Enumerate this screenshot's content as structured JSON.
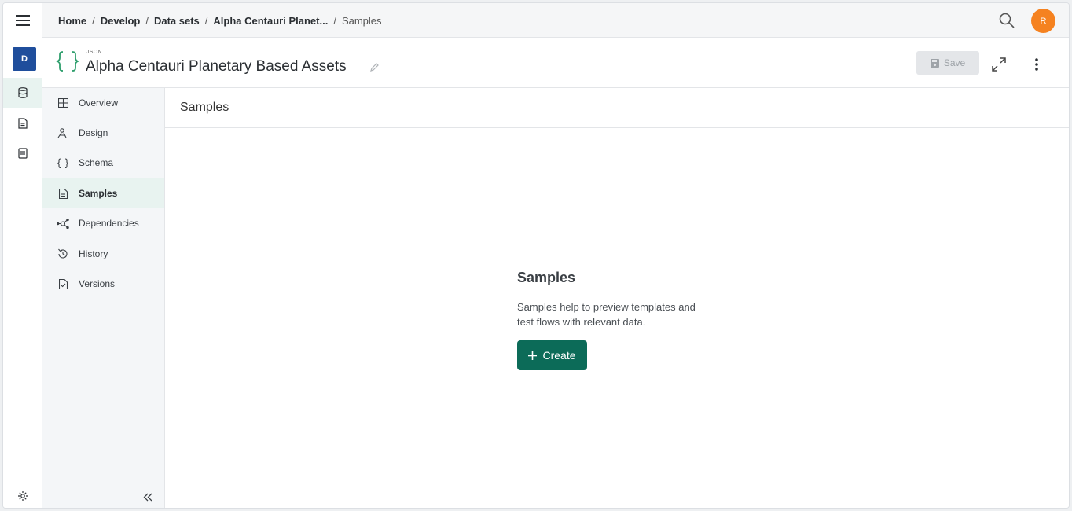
{
  "breadcrumb": {
    "items": [
      "Home",
      "Develop",
      "Data sets",
      "Alpha Centauri Planet..."
    ],
    "current": "Samples",
    "separator": "/"
  },
  "user": {
    "initial": "R",
    "color": "#f58220"
  },
  "rail": {
    "badge": "D"
  },
  "header": {
    "type_label": "JSON",
    "title": "Alpha Centauri Planetary Based Assets",
    "save_label": "Save"
  },
  "subnav": {
    "items": [
      {
        "label": "Overview",
        "icon": "grid-icon"
      },
      {
        "label": "Design",
        "icon": "design-icon"
      },
      {
        "label": "Schema",
        "icon": "braces-icon"
      },
      {
        "label": "Samples",
        "icon": "document-icon",
        "active": true
      },
      {
        "label": "Dependencies",
        "icon": "network-icon"
      },
      {
        "label": "History",
        "icon": "history-icon"
      },
      {
        "label": "Versions",
        "icon": "file-check-icon"
      }
    ]
  },
  "main": {
    "section_title": "Samples",
    "empty_title": "Samples",
    "empty_description_line1": "Samples help to preview templates and",
    "empty_description_line2": "test flows with relevant data.",
    "create_label": "Create"
  },
  "colors": {
    "accent": "#0c6b58",
    "active_bg": "#e8f3f0",
    "badge_blue": "#1f4e9c",
    "json_green": "#2e9e6c"
  }
}
